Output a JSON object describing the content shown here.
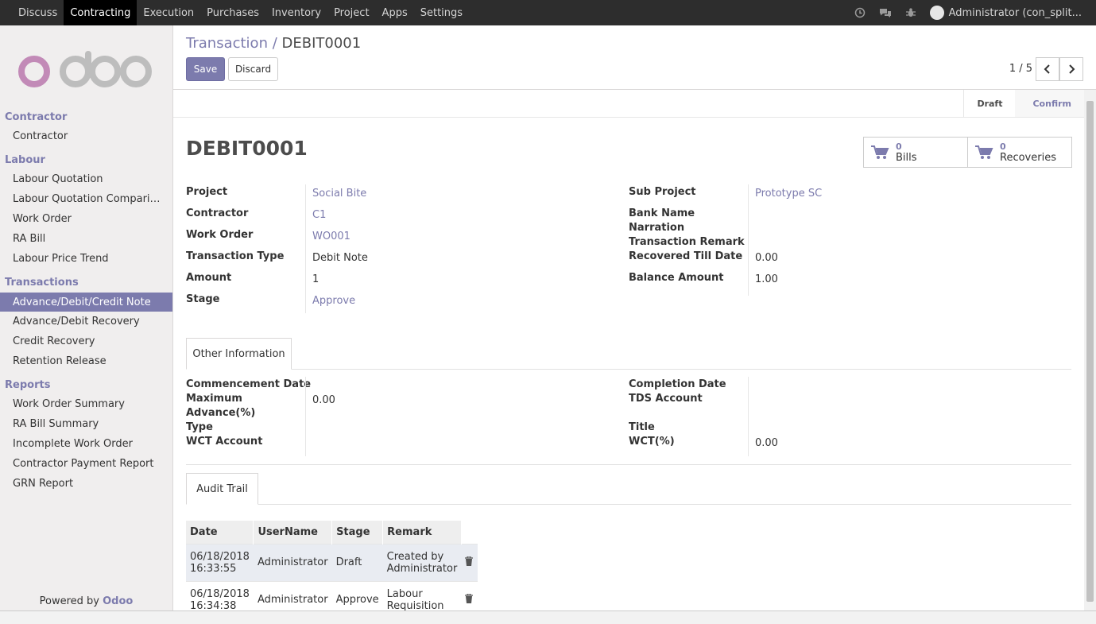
{
  "topbar": {
    "menu": [
      "Discuss",
      "Contracting",
      "Execution",
      "Purchases",
      "Inventory",
      "Project",
      "Apps",
      "Settings"
    ],
    "active": "Contracting",
    "user": "Administrator (con_split..."
  },
  "sidebar": {
    "sections": [
      {
        "title": "Contractor",
        "items": [
          "Contractor"
        ]
      },
      {
        "title": "Labour",
        "items": [
          "Labour Quotation",
          "Labour Quotation Compari…",
          "Work Order",
          "RA Bill",
          "Labour Price Trend"
        ]
      },
      {
        "title": "Transactions",
        "items": [
          "Advance/Debit/Credit Note",
          "Advance/Debit Recovery",
          "Credit Recovery",
          "Retention Release"
        ]
      },
      {
        "title": "Reports",
        "items": [
          "Work Order Summary",
          "RA Bill Summary",
          "Incomplete Work Order",
          "Contractor Payment Report",
          "GRN Report"
        ]
      }
    ],
    "active_item": "Advance/Debit/Credit Note",
    "powered_prefix": "Powered by",
    "powered_brand": "Odoo"
  },
  "control": {
    "breadcrumb_link": "Transaction /",
    "breadcrumb_current": "DEBIT0001",
    "save_label": "Save",
    "discard_label": "Discard",
    "pager": "1 / 5"
  },
  "status": {
    "stages": [
      "Draft",
      "Confirm"
    ],
    "current": "Draft"
  },
  "form": {
    "title": "DEBIT0001",
    "smart_buttons": [
      {
        "count": "0",
        "label": "Bills"
      },
      {
        "count": "0",
        "label": "Recoveries"
      }
    ],
    "left_labels": [
      "Project",
      "Contractor",
      "Work Order",
      "Transaction Type",
      "Amount",
      "Stage"
    ],
    "left_values": [
      "Social Bite",
      "C1",
      "WO001",
      "Debit Note",
      "1",
      "Approve"
    ],
    "right_labels": [
      "Sub Project",
      "Bank Name",
      "Narration",
      "Transaction Remark",
      "Recovered Till Date",
      "Balance Amount"
    ],
    "right_values": {
      "sub_project": "Prototype SC",
      "recovered": "0.00",
      "balance": "1.00"
    }
  },
  "tab1": {
    "label": "Other Information",
    "left_labels": [
      "Commencement Date",
      "Maximum",
      "Advance(%)",
      "Type",
      "WCT Account"
    ],
    "max_value": "0.00",
    "right_labels": [
      "Completion Date",
      "TDS Account",
      "Title",
      "WCT(%)"
    ],
    "wct_value": "0.00"
  },
  "tab2": {
    "label": "Audit Trail",
    "columns": [
      "Date",
      "UserName",
      "Stage",
      "Remark"
    ],
    "rows": [
      {
        "date1": "06/18/2018",
        "date2": "16:33:55",
        "user": "Administrator",
        "stage": "Draft",
        "remark1": "Created by",
        "remark2": "Administrator"
      },
      {
        "date1": "06/18/2018",
        "date2": "16:34:38",
        "user": "Administrator",
        "stage": "Approve",
        "remark1": "Labour",
        "remark2": "Requisition"
      }
    ]
  },
  "colors": {
    "accent": "#7c7bad",
    "navbar": "#2d2d2d",
    "sidebar": "#f0eeee"
  }
}
